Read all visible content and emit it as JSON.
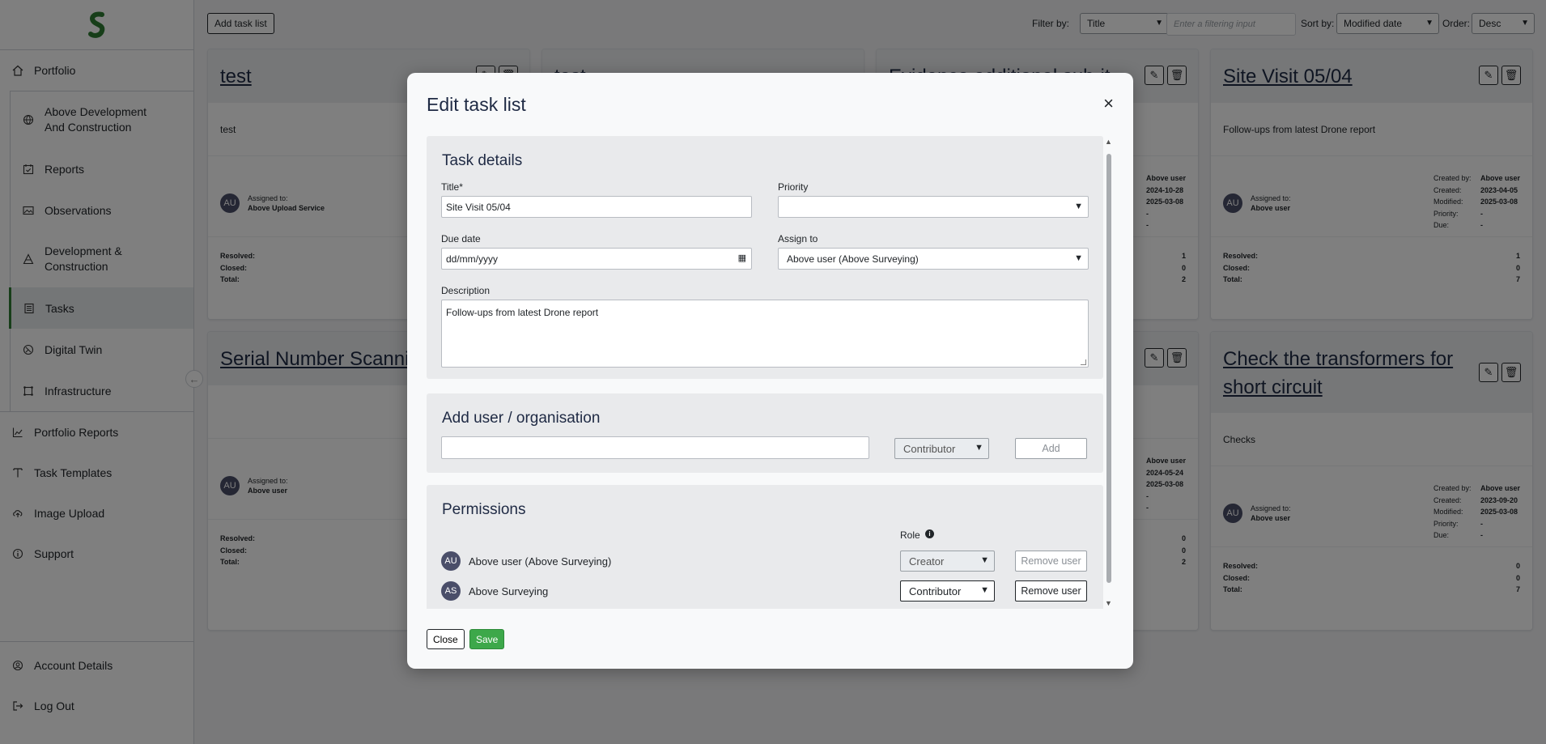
{
  "sidebar": {
    "logo_color": "#2e7d32",
    "items": [
      {
        "label": "Portfolio",
        "icon": "home-icon"
      },
      {
        "label": "Above Development And Construction",
        "icon": "globe-icon"
      },
      {
        "label": "Reports",
        "icon": "calendar-check-icon"
      },
      {
        "label": "Observations",
        "icon": "image-icon"
      },
      {
        "label": "Development & Construction",
        "icon": "cone-icon"
      },
      {
        "label": "Tasks",
        "icon": "list-icon",
        "active": true
      },
      {
        "label": "Digital Twin",
        "icon": "twin-icon"
      },
      {
        "label": "Infrastructure",
        "icon": "frame-icon"
      },
      {
        "label": "Portfolio Reports",
        "icon": "chart-icon"
      },
      {
        "label": "Task Templates",
        "icon": "template-icon"
      },
      {
        "label": "Image Upload",
        "icon": "upload-icon"
      },
      {
        "label": "Support",
        "icon": "info-icon"
      }
    ],
    "bottom": [
      {
        "label": "Account Details",
        "icon": "user-icon"
      },
      {
        "label": "Log Out",
        "icon": "logout-icon"
      }
    ]
  },
  "toolbar": {
    "add_label": "Add task list",
    "filter_label": "Filter by:",
    "filter_value": "Title",
    "filter_placeholder": "Enter a filtering input",
    "sort_label": "Sort by:",
    "sort_value": "Modified date",
    "order_label": "Order:",
    "order_value": "Desc"
  },
  "cards": {
    "c1": {
      "title": "test",
      "desc": "test",
      "assigned_label": "Assigned to:",
      "assigned": "Above Upload Service",
      "avatar": "AU",
      "resolved_label": "Resolved:",
      "closed_label": "Closed:",
      "total_label": "Total:"
    },
    "c2": {
      "title": "test"
    },
    "c3": {
      "title": "Evidence additional sub-it",
      "created_by": "Above user",
      "created": "2024-10-28",
      "modified": "2025-03-08",
      "priority": "-",
      "due": "-",
      "resolved": "1",
      "closed": "0",
      "total": "2"
    },
    "c4": {
      "title": "Site Visit 05/04",
      "desc": "Follow-ups from latest Drone report",
      "assigned_label": "Assigned to:",
      "assigned": "Above user",
      "avatar": "AU",
      "created_by_label": "Created by:",
      "created_label": "Created:",
      "modified_label": "Modified:",
      "priority_label": "Priority:",
      "due_label": "Due:",
      "created_by": "Above user",
      "created": "2023-04-05",
      "modified": "2025-03-08",
      "priority": "-",
      "due": "-",
      "resolved_label": "Resolved:",
      "closed_label": "Closed:",
      "total_label": "Total:",
      "resolved": "1",
      "closed": "0",
      "total": "7"
    },
    "c5": {
      "title": "Serial Number Scanning",
      "assigned_label": "Assigned to:",
      "assigned": "Above user",
      "avatar": "AU",
      "resolved_label": "Resolved:",
      "closed_label": "Closed:",
      "total_label": "Total:"
    },
    "c7": {
      "created_by": "Above user",
      "created": "2024-05-24",
      "modified": "2025-03-08",
      "priority": "-",
      "due": "-",
      "resolved": "0",
      "closed": "0",
      "total": "2"
    },
    "c8": {
      "title": "Check the transformers for short circuit",
      "desc": "Checks",
      "assigned_label": "Assigned to:",
      "assigned": "Above user",
      "avatar": "AU",
      "created_by_label": "Created by:",
      "created_label": "Created:",
      "modified_label": "Modified:",
      "priority_label": "Priority:",
      "due_label": "Due:",
      "created_by": "Above user",
      "created": "2023-09-20",
      "modified": "2025-03-08",
      "priority": "-",
      "due": "-",
      "resolved_label": "Resolved:",
      "closed_label": "Closed:",
      "total_label": "Total:",
      "resolved": "0",
      "closed": "0",
      "total": "7"
    }
  },
  "modal": {
    "title": "Edit task list",
    "close_glyph": "×",
    "details": {
      "heading": "Task details",
      "title_label": "Title*",
      "title_value": "Site Visit 05/04",
      "priority_label": "Priority",
      "priority_value": "",
      "due_label": "Due date",
      "due_value": "dd/mm/yyyy",
      "assign_label": "Assign to",
      "assign_value": "Above user (Above Surveying)",
      "desc_label": "Description",
      "desc_value": "Follow-ups from latest Drone report"
    },
    "add_user": {
      "heading": "Add user / organisation",
      "input_value": "",
      "role_value": "Contributor",
      "add_label": "Add"
    },
    "permissions": {
      "heading": "Permissions",
      "role_header": "Role",
      "rows": [
        {
          "avatar": "AU",
          "name": "Above user (Above Surveying)",
          "role": "Creator",
          "remove": "Remove user"
        },
        {
          "avatar": "AS",
          "name": "Above Surveying",
          "role": "Contributor",
          "remove": "Remove user"
        }
      ]
    },
    "close_label": "Close",
    "save_label": "Save"
  }
}
